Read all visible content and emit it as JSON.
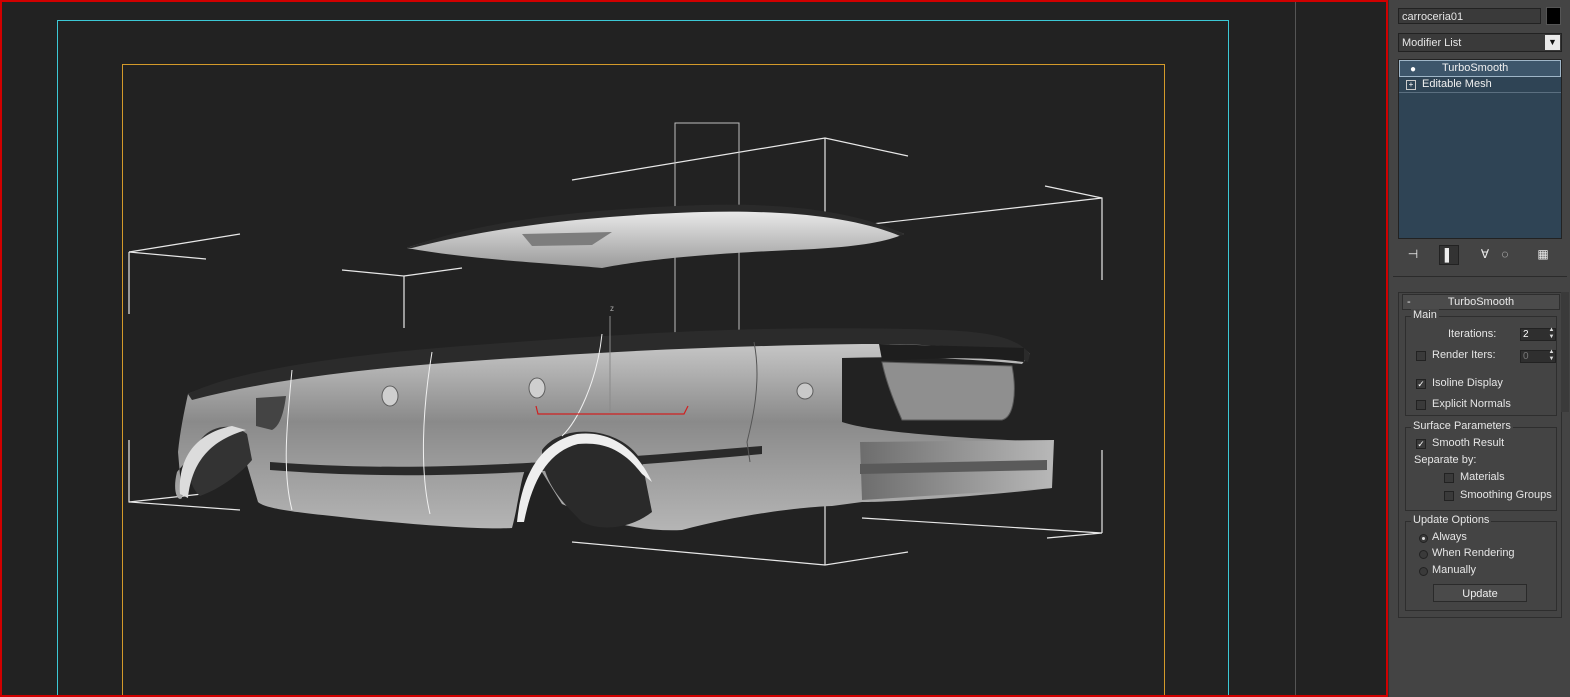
{
  "object_name": "carroceria01",
  "modifier_list": {
    "label": "Modifier List",
    "arrow": "▼"
  },
  "stack": [
    {
      "label": "TurboSmooth",
      "icon": "bulb-icon",
      "selected": true
    },
    {
      "label": "Editable Mesh",
      "icon": "expand-icon"
    }
  ],
  "stack_tools": [
    "pin-stack-icon",
    "show-end-result-icon",
    "make-unique-icon",
    "remove-modifier-icon",
    "configure-sets-icon"
  ],
  "viewport": {
    "axis_label": "z"
  },
  "rollout": {
    "title": "TurboSmooth",
    "collapse": "-",
    "main": {
      "label": "Main",
      "iterations_label": "Iterations:",
      "iterations_value": "2",
      "render_iters_label": "Render Iters:",
      "render_iters_value": "0",
      "isoline_label": "Isoline Display",
      "isoline_checked": true,
      "explicit_normals_label": "Explicit Normals",
      "explicit_normals_checked": false
    },
    "surface": {
      "label": "Surface Parameters",
      "smooth_result_label": "Smooth Result",
      "smooth_result_checked": true,
      "separate_by_label": "Separate by:",
      "materials_label": "Materials",
      "smoothing_groups_label": "Smoothing Groups"
    },
    "update_options": {
      "label": "Update Options",
      "always_label": "Always",
      "when_rendering_label": "When Rendering",
      "manually_label": "Manually",
      "selected": "Always",
      "update_button": "Update"
    }
  },
  "colors": {
    "viewport_border": "#d00000",
    "safe_frame_outer": "#3cc9d6",
    "safe_frame_inner": "#d49a2a",
    "stack_bg": "#2f4455"
  }
}
